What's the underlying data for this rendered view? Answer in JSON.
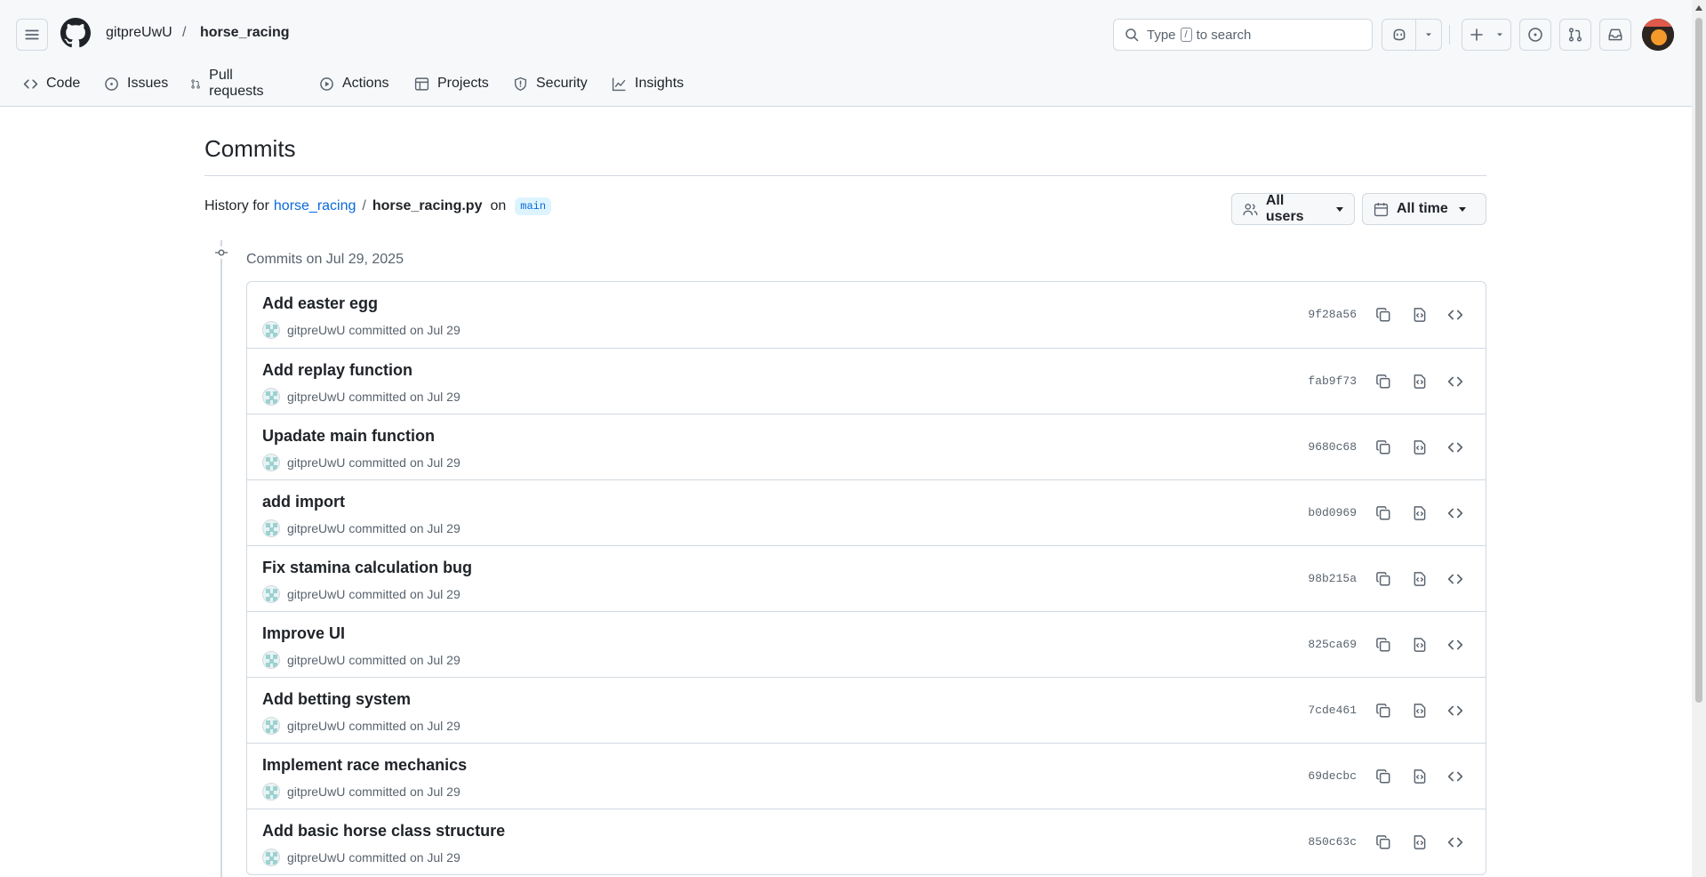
{
  "header": {
    "owner": "gitpreUwU",
    "separator": "/",
    "repo": "horse_racing",
    "search": {
      "before": "Type",
      "key": "/",
      "after": "to search"
    }
  },
  "tabs": [
    {
      "label": "Code",
      "icon": "code-icon"
    },
    {
      "label": "Issues",
      "icon": "issue-opened-icon"
    },
    {
      "label": "Pull requests",
      "icon": "git-pull-request-icon"
    },
    {
      "label": "Actions",
      "icon": "play-icon"
    },
    {
      "label": "Projects",
      "icon": "table-icon"
    },
    {
      "label": "Security",
      "icon": "shield-icon"
    },
    {
      "label": "Insights",
      "icon": "graph-icon"
    }
  ],
  "page": {
    "title": "Commits",
    "history_prefix": "History for",
    "history_repo": "horse_racing",
    "history_sep": "/",
    "history_file": "horse_racing.py",
    "history_on": "on",
    "branch": "main"
  },
  "filters": {
    "users": "All users",
    "time": "All time"
  },
  "group": {
    "label": "Commits on Jul 29, 2025"
  },
  "commits": [
    {
      "title": "Add easter egg",
      "author": "gitpreUwU",
      "verb": "committed",
      "date": "on Jul 29",
      "sha": "9f28a56"
    },
    {
      "title": "Add replay function",
      "author": "gitpreUwU",
      "verb": "committed",
      "date": "on Jul 29",
      "sha": "fab9f73"
    },
    {
      "title": "Upadate main function",
      "author": "gitpreUwU",
      "verb": "committed",
      "date": "on Jul 29",
      "sha": "9680c68"
    },
    {
      "title": "add import",
      "author": "gitpreUwU",
      "verb": "committed",
      "date": "on Jul 29",
      "sha": "b0d0969"
    },
    {
      "title": "Fix stamina calculation bug",
      "author": "gitpreUwU",
      "verb": "committed",
      "date": "on Jul 29",
      "sha": "98b215a"
    },
    {
      "title": "Improve UI",
      "author": "gitpreUwU",
      "verb": "committed",
      "date": "on Jul 29",
      "sha": "825ca69"
    },
    {
      "title": "Add betting system",
      "author": "gitpreUwU",
      "verb": "committed",
      "date": "on Jul 29",
      "sha": "7cde461"
    },
    {
      "title": "Implement race mechanics",
      "author": "gitpreUwU",
      "verb": "committed",
      "date": "on Jul 29",
      "sha": "69decbc"
    },
    {
      "title": "Add basic horse class structure",
      "author": "gitpreUwU",
      "verb": "committed",
      "date": "on Jul 29",
      "sha": "850c63c"
    }
  ],
  "colors": {
    "link": "#0969da",
    "text": "#1f2328",
    "muted": "#59636e",
    "border": "#d1d9e0",
    "header_bg": "#f6f8fa"
  }
}
